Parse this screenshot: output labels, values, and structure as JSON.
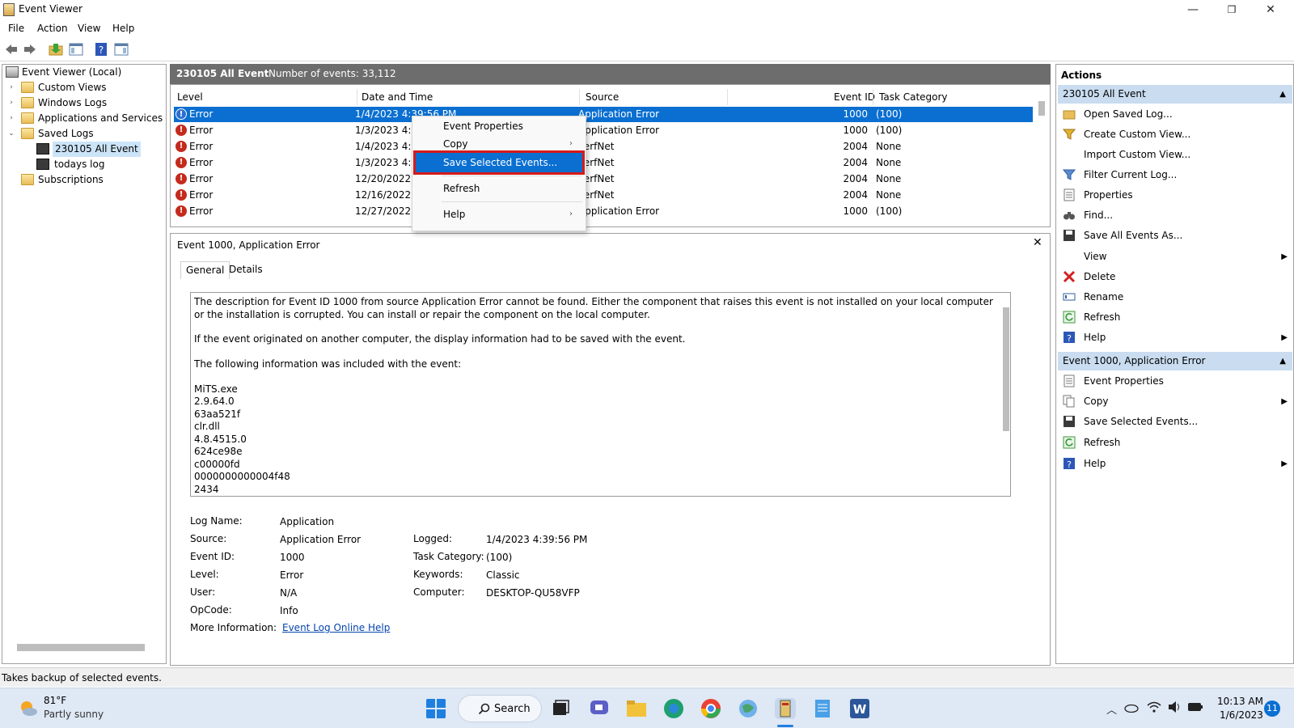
{
  "window": {
    "title": "Event Viewer",
    "controls": {
      "minimize": "—",
      "restore": "❐",
      "close": "✕"
    }
  },
  "menu": [
    "File",
    "Action",
    "View",
    "Help"
  ],
  "toolbar": {
    "icons": [
      "back-arrow-icon",
      "forward-arrow-icon",
      "open-folder-icon",
      "show-hide-console-tree-icon",
      "help-icon",
      "show-hide-action-pane-icon"
    ]
  },
  "tree": {
    "items": [
      {
        "label": "Event Viewer (Local)",
        "icon": "event-viewer-icon",
        "arrow": ""
      },
      {
        "label": "Custom Views",
        "icon": "folder-icon",
        "arrow": "›"
      },
      {
        "label": "Windows Logs",
        "icon": "folder-icon",
        "arrow": "›"
      },
      {
        "label": "Applications and Services Log",
        "icon": "folder-icon",
        "arrow": "›"
      },
      {
        "label": "Saved Logs",
        "icon": "folder-icon",
        "arrow": "⌄"
      },
      {
        "label": "230105 All Event",
        "icon": "disk-icon",
        "arrow": ""
      },
      {
        "label": "todays log",
        "icon": "disk-icon",
        "arrow": ""
      },
      {
        "label": "Subscriptions",
        "icon": "folder-icon",
        "arrow": ""
      }
    ]
  },
  "center": {
    "log_title": "230105 All Event",
    "event_count": "Number of events: 33,112"
  },
  "grid": {
    "columns": [
      "Level",
      "Date and Time",
      "Source",
      "Event ID",
      "Task Category"
    ],
    "rows": [
      {
        "level": "Error",
        "date": "1/4/2023 4:39:56 PM",
        "source": "Application Error",
        "id": "1000",
        "category": "(100)"
      },
      {
        "level": "Error",
        "date": "1/3/2023 4:2",
        "source": "Application Error",
        "id": "1000",
        "category": "(100)"
      },
      {
        "level": "Error",
        "date": "1/4/2023 4:3",
        "source": "PerfNet",
        "id": "2004",
        "category": "None"
      },
      {
        "level": "Error",
        "date": "1/3/2023 4:1",
        "source": "PerfNet",
        "id": "2004",
        "category": "None"
      },
      {
        "level": "Error",
        "date": "12/20/2022",
        "source": "PerfNet",
        "id": "2004",
        "category": "None"
      },
      {
        "level": "Error",
        "date": "12/16/2022",
        "source": "PerfNet",
        "id": "2004",
        "category": "None"
      },
      {
        "level": "Error",
        "date": "12/27/2022",
        "source": "Application Error",
        "id": "1000",
        "category": "(100)"
      }
    ]
  },
  "context_menu": {
    "items": [
      "Event Properties",
      "Copy",
      "Save Selected Events...",
      "Refresh",
      "Help"
    ],
    "submenu_glyph": "›"
  },
  "detail": {
    "header": "Event 1000, Application Error",
    "close": "✕",
    "tabs": [
      "General",
      "Details"
    ],
    "description": [
      "The description for Event ID 1000 from source Application Error cannot be found. Either the component that raises this event is not installed on your local computer or the installation is corrupted. You can install or repair the component on the local computer.",
      "If the event originated on another computer, the display information had to be saved with the event.",
      "The following information was included with the event:",
      "MiTS.exe",
      "2.9.64.0",
      "63aa521f",
      "clr.dll",
      "4.8.4515.0",
      "624ce98e",
      "c00000fd",
      "0000000000004f48",
      "2434"
    ],
    "fields": {
      "log_name_label": "Log Name:",
      "log_name": "Application",
      "source_label": "Source:",
      "source": "Application Error",
      "logged_label": "Logged:",
      "logged": "1/4/2023 4:39:56 PM",
      "event_id_label": "Event ID:",
      "event_id": "1000",
      "task_category_label": "Task Category:",
      "task_category": "(100)",
      "level_label": "Level:",
      "level": "Error",
      "keywords_label": "Keywords:",
      "keywords": "Classic",
      "user_label": "User:",
      "user": "N/A",
      "computer_label": "Computer:",
      "computer": "DESKTOP-QU58VFP",
      "opcode_label": "OpCode:",
      "opcode": "Info",
      "more_info_label": "More Information:",
      "more_info_link": "Event Log Online Help"
    }
  },
  "actions": {
    "title": "Actions",
    "section1": {
      "header": "230105 All Event",
      "items": [
        {
          "label": "Open Saved Log...",
          "icon": "open-folder-icon",
          "sub": ""
        },
        {
          "label": "Create Custom View...",
          "icon": "filter-icon",
          "sub": ""
        },
        {
          "label": "Import Custom View...",
          "icon": "none",
          "sub": ""
        },
        {
          "label": "Filter Current Log...",
          "icon": "filter-icon",
          "sub": ""
        },
        {
          "label": "Properties",
          "icon": "properties-icon",
          "sub": ""
        },
        {
          "label": "Find...",
          "icon": "binoculars-icon",
          "sub": ""
        },
        {
          "label": "Save All Events As...",
          "icon": "disk-icon",
          "sub": ""
        },
        {
          "label": "View",
          "icon": "none",
          "sub": "▶"
        },
        {
          "label": "Delete",
          "icon": "delete-x-icon",
          "sub": ""
        },
        {
          "label": "Rename",
          "icon": "rename-icon",
          "sub": ""
        },
        {
          "label": "Refresh",
          "icon": "refresh-icon",
          "sub": ""
        },
        {
          "label": "Help",
          "icon": "help-icon",
          "sub": "▶"
        }
      ]
    },
    "section2": {
      "header": "Event 1000, Application Error",
      "items": [
        {
          "label": "Event Properties",
          "icon": "properties-icon",
          "sub": ""
        },
        {
          "label": "Copy",
          "icon": "copy-icon",
          "sub": "▶"
        },
        {
          "label": "Save Selected Events...",
          "icon": "disk-icon",
          "sub": ""
        },
        {
          "label": "Refresh",
          "icon": "refresh-icon",
          "sub": ""
        },
        {
          "label": "Help",
          "icon": "help-icon",
          "sub": "▶"
        }
      ]
    },
    "collapse_glyph": "▲"
  },
  "status": {
    "text": "Takes backup of selected events."
  },
  "taskbar": {
    "weather": {
      "temp": "81°F",
      "condition": "Partly sunny"
    },
    "search_label": "Search",
    "clock": {
      "time": "10:13 AM",
      "date": "1/6/2023"
    },
    "notification_count": "11",
    "tray": {
      "chevron": "︿",
      "volume": "🔊"
    }
  },
  "colors": {
    "selection": "#0a6fd1",
    "header_bar": "#6d6d6d",
    "highlight_border": "#d61a1a",
    "actions_section": "#c9dcf0",
    "error_icon": "#c42b1c"
  }
}
